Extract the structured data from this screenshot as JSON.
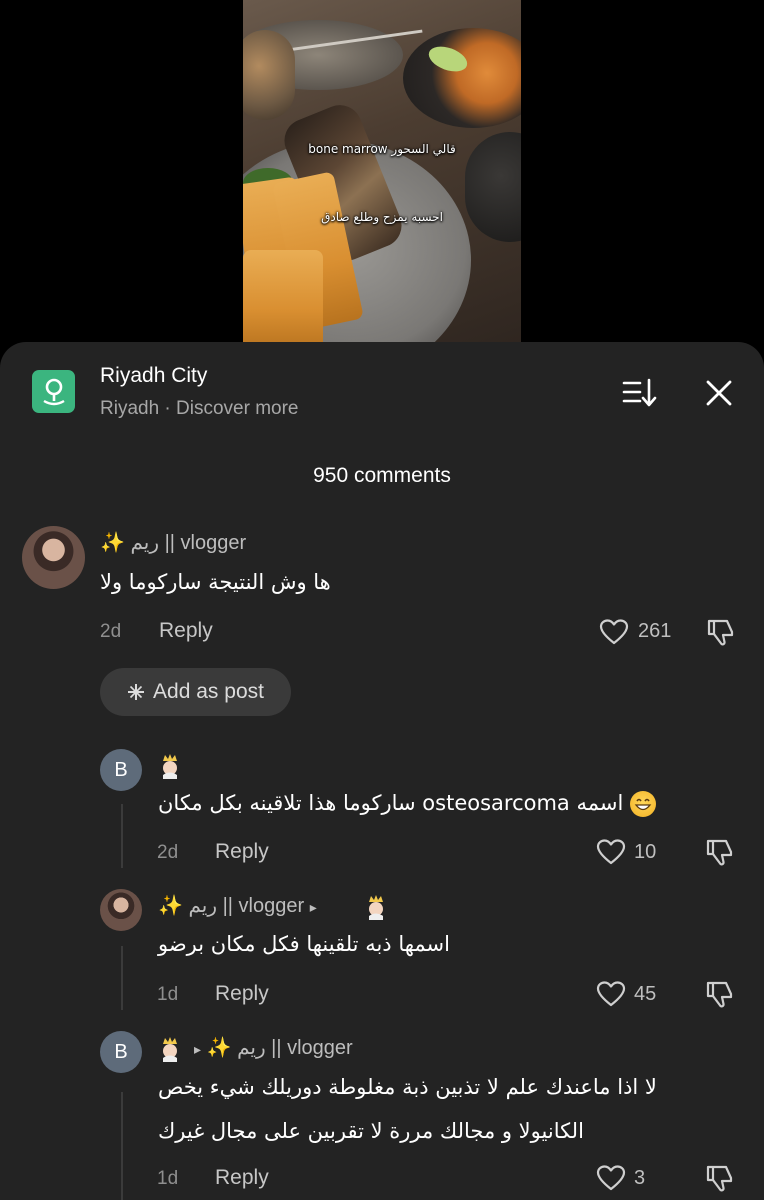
{
  "video": {
    "caption_line1": "قالي السحور bone marrow",
    "caption_line2": "احسبه يمزح وطلع صادق"
  },
  "header": {
    "location_title": "Riyadh City",
    "location_subtitle": "Riyadh · Discover more",
    "icons": {
      "location": "map-pin-icon",
      "sort": "sort-icon",
      "close": "close-icon"
    },
    "accent_color": "#3bb57f"
  },
  "comments_count": "950 comments",
  "comments": [
    {
      "username": "ريم || vlogger",
      "sparkle": "✨",
      "text": "ها وش النتيجة ساركوما ولا",
      "time": "2d",
      "reply_label": "Reply",
      "likes": "261",
      "add_post_label": "Add as post"
    }
  ],
  "replies": [
    {
      "avatar_letter": "B",
      "text": "اسمه osteosarcoma ساركوما هذا تلاقينه بكل مكان",
      "time": "2d",
      "reply_label": "Reply",
      "likes": "10"
    },
    {
      "username": "ريم || vlogger",
      "sparkle": "✨",
      "arrow": "▸",
      "text": "اسمها ذبه تلقينها فكل مكان برضو",
      "time": "1d",
      "reply_label": "Reply",
      "likes": "45"
    },
    {
      "avatar_letter": "B",
      "arrow": "▸",
      "sparkle": "✨",
      "username": "ريم || vlogger",
      "text_line1": "لا اذا ماعندك علم لا تذبين ذبة مغلوطة دوريلك شيء يخص",
      "text_line2": "الكانيولا و مجالك مررة لا تقربين على مجال غيرك",
      "time": "1d",
      "reply_label": "Reply",
      "likes": "3"
    }
  ]
}
